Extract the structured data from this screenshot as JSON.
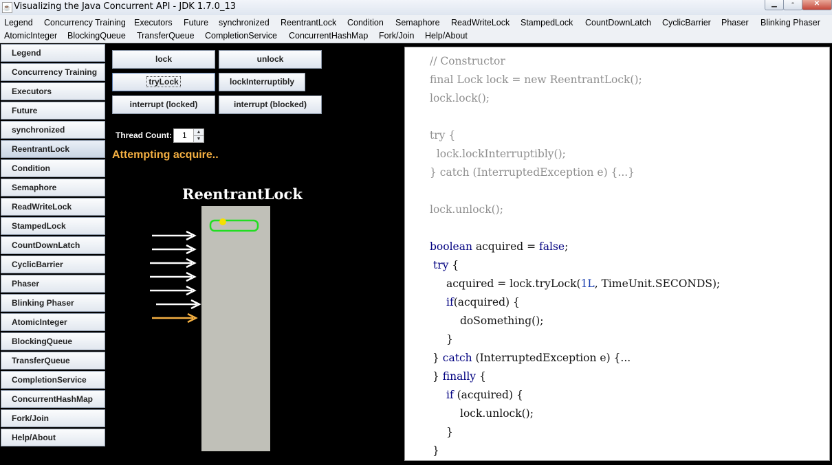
{
  "window": {
    "title": "Visualizing the Java Concurrent API - JDK 1.7.0_13",
    "app_icon": "java-cup-icon",
    "controls": [
      "minimize-icon",
      "maximize-icon",
      "close-icon"
    ]
  },
  "menu": {
    "row1": [
      "Legend",
      "Concurrency Training",
      "Executors",
      "Future",
      "synchronized",
      "ReentrantLock",
      "Condition",
      "Semaphore",
      "ReadWriteLock",
      "StampedLock",
      "CountDownLatch",
      "CyclicBarrier",
      "Phaser",
      "Blinking Phaser"
    ],
    "row2": [
      "AtomicInteger",
      "BlockingQueue",
      "TransferQueue",
      "CompletionService",
      "ConcurrentHashMap",
      "Fork/Join",
      "Help/About"
    ]
  },
  "sidebar": {
    "selected": "ReentrantLock",
    "items": [
      "Legend",
      "Concurrency Training",
      "Executors",
      "Future",
      "synchronized",
      "ReentrantLock",
      "Condition",
      "Semaphore",
      "ReadWriteLock",
      "StampedLock",
      "CountDownLatch",
      "CyclicBarrier",
      "Phaser",
      "Blinking Phaser",
      "AtomicInteger",
      "BlockingQueue",
      "TransferQueue",
      "CompletionService",
      "ConcurrentHashMap",
      "Fork/Join",
      "Help/About"
    ]
  },
  "actions": {
    "lock": "lock",
    "unlock": "unlock",
    "trylock": "tryLock",
    "lock_interruptibly": "lockInterruptibly",
    "interrupt_locked": "interrupt (locked)",
    "interrupt_blocked": "interrupt (blocked)"
  },
  "thread_count": {
    "label": "Thread Count:",
    "value": "1"
  },
  "status": "Attempting acquire..",
  "visual": {
    "title": "ReentrantLock",
    "waiting_threads_white": 6,
    "attempting_threads_orange": 1,
    "colors": {
      "monitor": "#c0c0b8",
      "lock_outline": "#22dd22",
      "lock_holder_dot": "#f5e000",
      "waiting_arrow": "#ffffff",
      "attempting_arrow": "#f5b042"
    }
  },
  "code": {
    "faded_lines": [
      "// Constructor",
      "final Lock lock = new ReentrantLock();",
      "lock.lock();",
      "",
      "try {",
      "  lock.lockInterruptibly();",
      "} catch (InterruptedException e) {...}",
      "",
      "lock.unlock();"
    ],
    "l_boolean_kw": "boolean",
    "l_boolean_mid": " acquired = ",
    "l_boolean_false": "false",
    "l_boolean_end": ";",
    "l_try": "try",
    "l_try_end": " {",
    "l_acquired_a": "acquired = lock.tryLock(",
    "l_acquired_num": "1L",
    "l_acquired_b": ", TimeUnit.SECONDS);",
    "l_if_kw": "if",
    "l_if_rest": "(acquired) {",
    "l_do": "doSomething();",
    "l_close1": "}",
    "l_catch_brace": "} ",
    "l_catch_kw": "catch",
    "l_catch_rest": " (InterruptedException e) {...",
    "l_finally_brace": "} ",
    "l_finally_kw": "finally",
    "l_finally_rest": " {",
    "l_if2_kw": "if",
    "l_if2_rest": " (acquired) {",
    "l_unlock": "lock.unlock();",
    "l_close2": "}",
    "l_close3": "}"
  }
}
